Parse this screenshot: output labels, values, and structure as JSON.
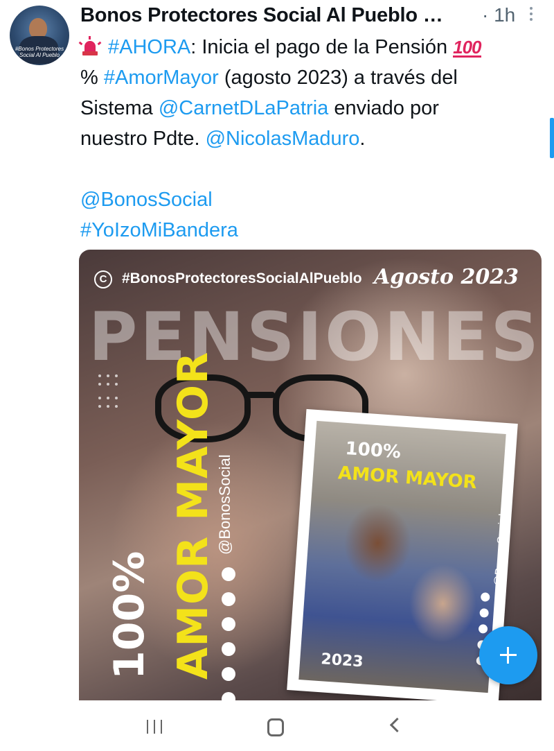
{
  "header": {
    "author_name": "Bonos Protectores Social Al Pueblo …",
    "time": "· 1h",
    "avatar_text": "#Bonos Protectores Social Al Pueblo"
  },
  "tweet": {
    "line1_hashtag": "#AHORA",
    "line1_text": ": Inicia el pago de la Pensión",
    "emoji_100": "100",
    "line2_percent": "% ",
    "line2_hashtag": "#AmorMayor",
    "line2_text": " (agosto 2023) a través del",
    "line3_text": "Sistema ",
    "line3_mention": "@CarnetDLaPatria",
    "line3_text2": " enviado por",
    "line4_text": "nuestro Pdte. ",
    "line4_mention": "@NicolasMaduro",
    "line4_text2": ".",
    "line5_mention": "@BonosSocial",
    "line6_hashtag": "#YoIzoMiBandera"
  },
  "media": {
    "handle_symbol": "C",
    "handle": "#BonosProtectoresSocialAlPueblo",
    "date": "Agosto 2023",
    "headline": "PENSIONES",
    "vertical_100": "100%",
    "vertical_amor": "AMOR MAYOR",
    "vertical_bonos": "@BonosSocial",
    "card_100": "100%",
    "card_amor": "AMOR MAYOR",
    "card_year": "2023",
    "card_bonos": "@BonosSocial"
  },
  "colors": {
    "link": "#1d9bf0",
    "accent_yellow": "#f3e21a",
    "fab": "#1d9bf0"
  },
  "icons": {
    "fab": "plus-icon",
    "more": "more-vertical-icon",
    "nav": [
      "recents-icon",
      "home-icon",
      "back-icon"
    ]
  }
}
